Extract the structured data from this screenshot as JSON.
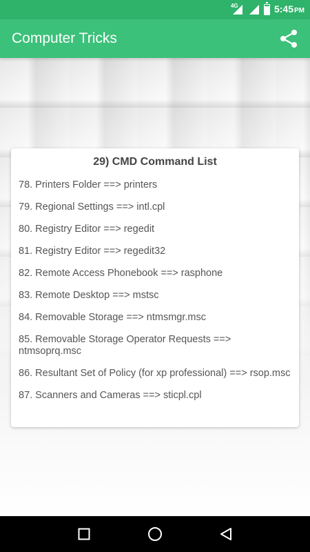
{
  "status_bar": {
    "network_label": "4G",
    "time": "5:45",
    "ampm": "PM",
    "battery_level": 0.85
  },
  "app_bar": {
    "title": "Computer Tricks",
    "share_icon": "share-icon"
  },
  "card": {
    "title": "29) CMD Command List",
    "items": [
      "78. Printers Folder ==> printers",
      "79. Regional Settings ==> intl.cpl",
      "80. Registry Editor ==> regedit",
      "81. Registry Editor ==> regedit32",
      "82. Remote Access Phonebook ==> rasphone",
      "83. Remote Desktop ==> mstsc",
      "84. Removable Storage ==> ntmsmgr.msc",
      "85. Removable Storage Operator Requests ==> ntmsoprq.msc",
      "86. Resultant Set of Policy (for xp professional) ==> rsop.msc",
      "87. Scanners and Cameras ==> sticpl.cpl"
    ]
  },
  "nav_bar": {
    "recents_icon": "square-icon",
    "home_icon": "circle-icon",
    "back_icon": "triangle-back-icon"
  },
  "colors": {
    "status_bar": "#2fb36a",
    "app_bar": "#3cc17a",
    "text": "#555555"
  }
}
